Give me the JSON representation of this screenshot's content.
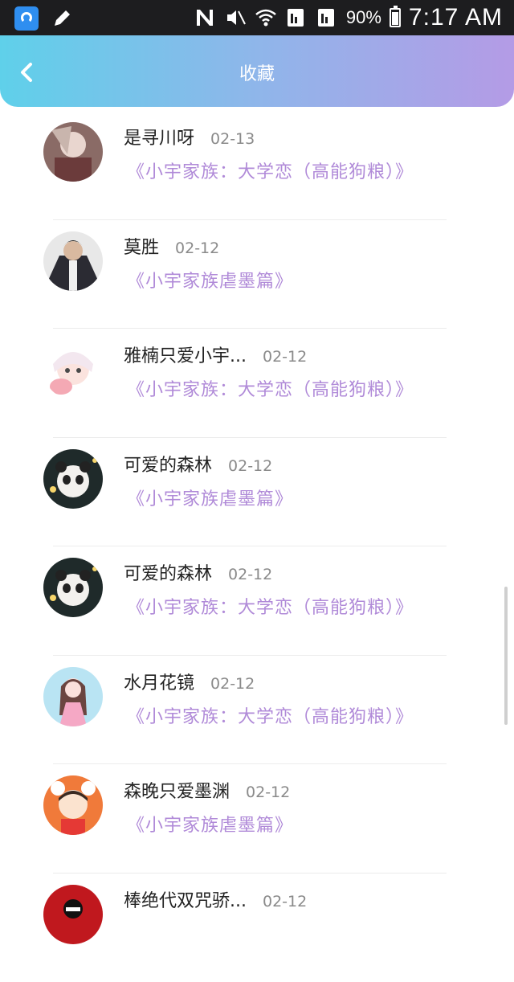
{
  "status_bar": {
    "battery_percent": "90%",
    "battery_level": 0.9,
    "time": "7:17 AM"
  },
  "header": {
    "title": "收藏"
  },
  "items": [
    {
      "name": "是寻川呀",
      "date": "02-13",
      "story": "《小宇家族：大学恋（高能狗粮）》"
    },
    {
      "name": "莫胜",
      "date": "02-12",
      "story": "《小宇家族虐墨篇》"
    },
    {
      "name": "雅楠只爱小宇...",
      "date": "02-12",
      "story": "《小宇家族：大学恋（高能狗粮）》"
    },
    {
      "name": "可爱的森林",
      "date": "02-12",
      "story": "《小宇家族虐墨篇》"
    },
    {
      "name": "可爱的森林",
      "date": "02-12",
      "story": "《小宇家族：大学恋（高能狗粮）》"
    },
    {
      "name": "水月花镜",
      "date": "02-12",
      "story": "《小宇家族：大学恋（高能狗粮）》"
    },
    {
      "name": "森晚只爱墨渊",
      "date": "02-12",
      "story": "《小宇家族虐墨篇》"
    },
    {
      "name": "棒绝代双咒骄...",
      "date": "02-12",
      "story": ""
    }
  ]
}
